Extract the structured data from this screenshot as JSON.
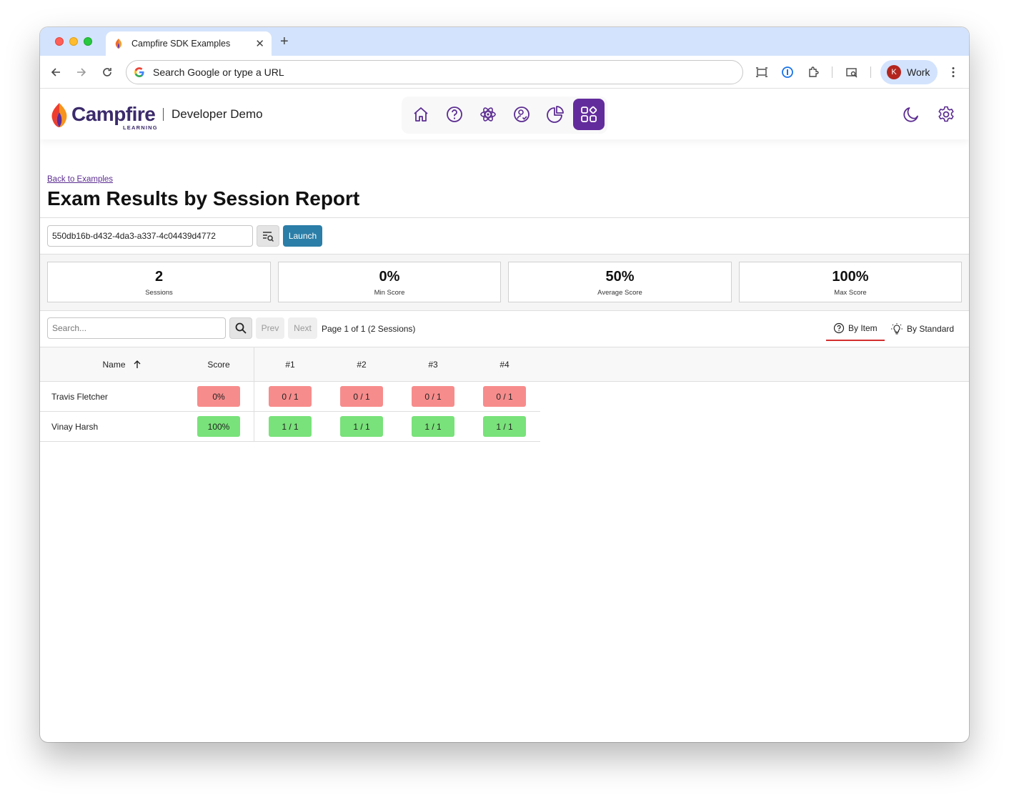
{
  "browser": {
    "tab_title": "Campfire SDK Examples",
    "omnibox_placeholder": "Search Google or type a URL",
    "profile_initial": "K",
    "profile_label": "Work"
  },
  "header": {
    "brand": "Campfire",
    "brand_sub": "LEARNING",
    "subtitle": "Developer Demo",
    "nav_icons": [
      "home-icon",
      "question-icon",
      "atom-icon",
      "user-check-icon",
      "pie-chart-icon",
      "grid-icon"
    ],
    "active_nav": "grid-icon",
    "right_icons": [
      "moon-icon",
      "gear-icon"
    ]
  },
  "page": {
    "back_link": "Back to Examples",
    "title": "Exam Results by Session Report",
    "session_id": "550db16b-d432-4da3-a337-4c04439d4772",
    "launch_label": "Launch"
  },
  "stats": [
    {
      "value": "2",
      "label": "Sessions"
    },
    {
      "value": "0%",
      "label": "Min Score"
    },
    {
      "value": "50%",
      "label": "Average Score"
    },
    {
      "value": "100%",
      "label": "Max Score"
    }
  ],
  "filter": {
    "search_placeholder": "Search...",
    "prev_label": "Prev",
    "next_label": "Next",
    "page_info": "Page 1 of 1 (2 Sessions)",
    "view_tabs": [
      "By Item",
      "By Standard"
    ],
    "active_view": "By Item"
  },
  "table": {
    "columns": [
      "Name",
      "Score",
      "#1",
      "#2",
      "#3",
      "#4"
    ],
    "sort": {
      "column": "Name",
      "direction": "ascending"
    },
    "rows": [
      {
        "name": "Travis Fletcher",
        "score": "0%",
        "items": [
          "0 / 1",
          "0 / 1",
          "0 / 1",
          "0 / 1"
        ],
        "status": "incorrect"
      },
      {
        "name": "Vinay Harsh",
        "score": "100%",
        "items": [
          "1 / 1",
          "1 / 1",
          "1 / 1",
          "1 / 1"
        ],
        "status": "correct"
      }
    ]
  },
  "colors": {
    "brand_purple": "#632c9c",
    "launch_blue": "#2b7ea7",
    "incorrect": "#f78c8c",
    "correct": "#79e27a",
    "active_tab_underline": "#d32f2f"
  }
}
